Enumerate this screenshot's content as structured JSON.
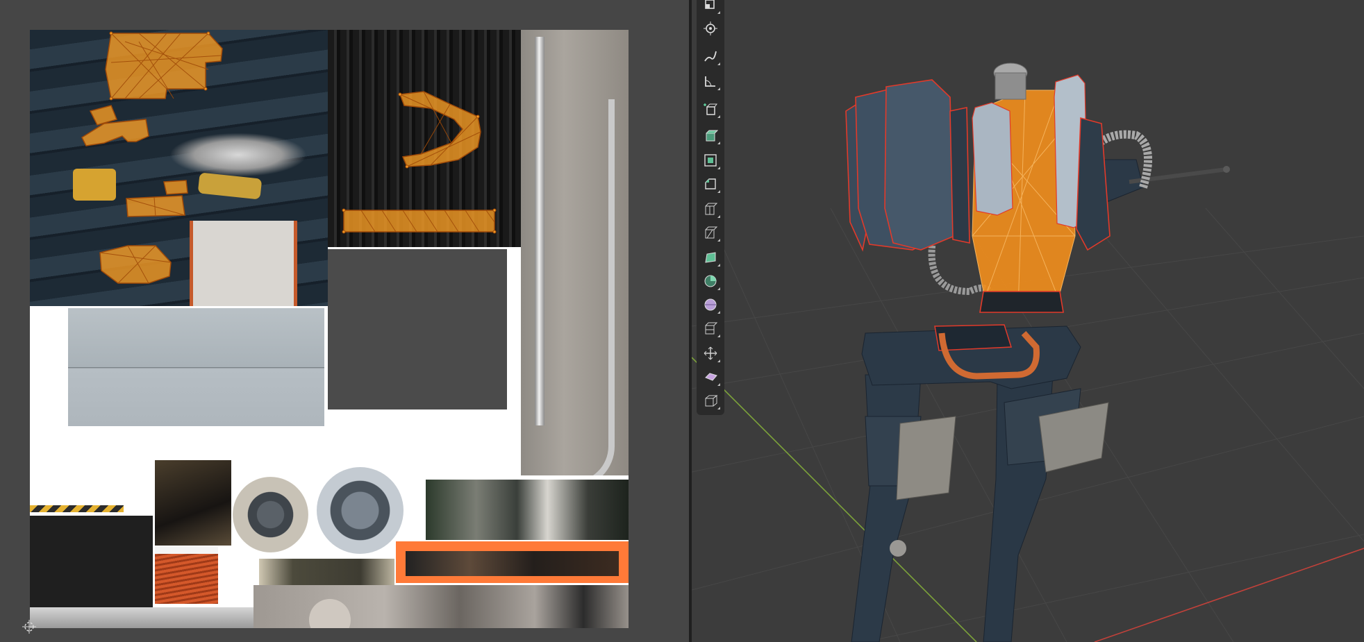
{
  "uv_editor": {
    "texture_patches": [
      "capsule-hull",
      "black-stripes",
      "pipe-and-cable",
      "dark-gray-panel",
      "light-gray-panel",
      "hazard-stripe",
      "black-block",
      "mechanism",
      "orange-wire",
      "disc-small",
      "disc-large",
      "machinery",
      "orange-frame",
      "panel",
      "concrete"
    ]
  },
  "viewport": {
    "model": "mech-walker",
    "selection_color": "#f28e1c",
    "edge_color": "#e23a2a",
    "axis_x_color": "#c2413a",
    "axis_y_color": "#7da33a"
  },
  "toolbar": {
    "tools": [
      {
        "name": "transform-tool-icon",
        "active": false
      },
      {
        "name": "annotate-tool-icon",
        "active": false
      },
      {
        "name": "measure-tool-icon",
        "active": false
      },
      {
        "name": "add-cube-tool-icon",
        "active": false
      },
      {
        "name": "extrude-region-tool-icon",
        "active": false
      },
      {
        "name": "inset-faces-tool-icon",
        "active": false
      },
      {
        "name": "bevel-tool-icon",
        "active": false
      },
      {
        "name": "loop-cut-tool-icon",
        "active": false
      },
      {
        "name": "knife-tool-icon",
        "active": false
      },
      {
        "name": "poly-build-tool-icon",
        "active": false
      },
      {
        "name": "spin-tool-icon",
        "active": false
      },
      {
        "name": "smooth-tool-icon",
        "active": false
      },
      {
        "name": "edge-slide-tool-icon",
        "active": false
      },
      {
        "name": "shrink-fatten-tool-icon",
        "active": false
      },
      {
        "name": "shear-tool-icon",
        "active": false
      },
      {
        "name": "rip-region-tool-icon",
        "active": false
      }
    ]
  }
}
